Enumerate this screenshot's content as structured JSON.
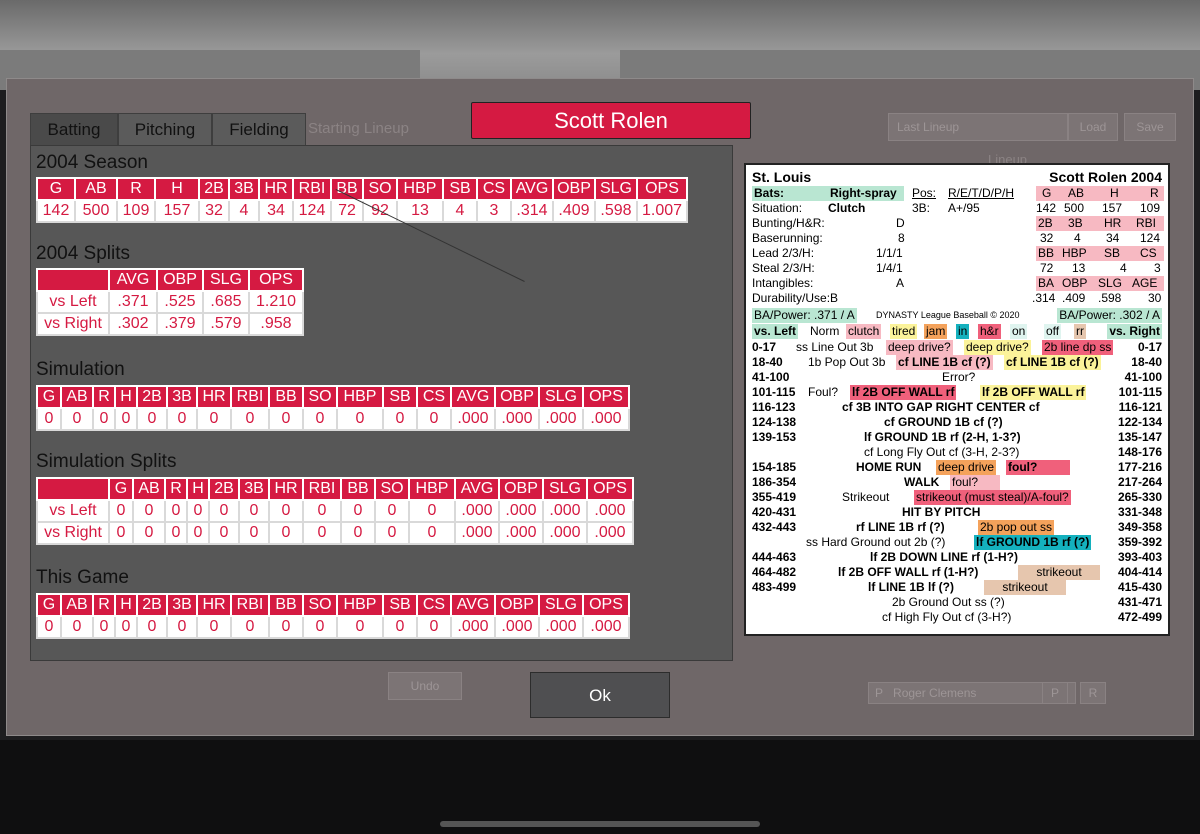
{
  "tabs": [
    {
      "label": "Batting",
      "active": true
    },
    {
      "label": "Pitching",
      "active": false
    },
    {
      "label": "Fielding",
      "active": false
    }
  ],
  "player_name": "Scott Rolen",
  "background": {
    "starting_lineup": "Starting Lineup",
    "last_lineup": "Last Lineup",
    "load": "Load",
    "save": "Save",
    "lineup": "Lineup",
    "undo": "Undo",
    "pitcher_pos": "P",
    "pitcher_name": "Roger Clemens",
    "p_label": "P",
    "r_label": "R"
  },
  "season": {
    "title": "2004 Season",
    "headers": [
      "G",
      "AB",
      "R",
      "H",
      "2B",
      "3B",
      "HR",
      "RBI",
      "BB",
      "SO",
      "HBP",
      "SB",
      "CS",
      "AVG",
      "OBP",
      "SLG",
      "OPS"
    ],
    "values": [
      "142",
      "500",
      "109",
      "157",
      "32",
      "4",
      "34",
      "124",
      "72",
      "92",
      "13",
      "4",
      "3",
      ".314",
      ".409",
      ".598",
      "1.007"
    ]
  },
  "splits": {
    "title": "2004 Splits",
    "headers": [
      "",
      "AVG",
      "OBP",
      "SLG",
      "OPS"
    ],
    "rows": [
      [
        "vs Left",
        ".371",
        ".525",
        ".685",
        "1.210"
      ],
      [
        "vs Right",
        ".302",
        ".379",
        ".579",
        ".958"
      ]
    ]
  },
  "simulation": {
    "title": "Simulation",
    "headers": [
      "G",
      "AB",
      "R",
      "H",
      "2B",
      "3B",
      "HR",
      "RBI",
      "BB",
      "SO",
      "HBP",
      "SB",
      "CS",
      "AVG",
      "OBP",
      "SLG",
      "OPS"
    ],
    "values": [
      "0",
      "0",
      "0",
      "0",
      "0",
      "0",
      "0",
      "0",
      "0",
      "0",
      "0",
      "0",
      "0",
      ".000",
      ".000",
      ".000",
      ".000"
    ]
  },
  "sim_splits": {
    "title": "Simulation Splits",
    "headers": [
      "",
      "G",
      "AB",
      "R",
      "H",
      "2B",
      "3B",
      "HR",
      "RBI",
      "BB",
      "SO",
      "HBP",
      "AVG",
      "OBP",
      "SLG",
      "OPS"
    ],
    "rows": [
      [
        "vs Left",
        "0",
        "0",
        "0",
        "0",
        "0",
        "0",
        "0",
        "0",
        "0",
        "0",
        "0",
        ".000",
        ".000",
        ".000",
        ".000"
      ],
      [
        "vs Right",
        "0",
        "0",
        "0",
        "0",
        "0",
        "0",
        "0",
        "0",
        "0",
        "0",
        "0",
        ".000",
        ".000",
        ".000",
        ".000"
      ]
    ]
  },
  "this_game": {
    "title": "This Game",
    "headers": [
      "G",
      "AB",
      "R",
      "H",
      "2B",
      "3B",
      "HR",
      "RBI",
      "BB",
      "SO",
      "HBP",
      "SB",
      "CS",
      "AVG",
      "OBP",
      "SLG",
      "OPS"
    ],
    "values": [
      "0",
      "0",
      "0",
      "0",
      "0",
      "0",
      "0",
      "0",
      "0",
      "0",
      "0",
      "0",
      "0",
      ".000",
      ".000",
      ".000",
      ".000"
    ]
  },
  "card": {
    "team": "St. Louis",
    "player_year": "Scott Rolen 2004",
    "bats_label": "Bats:",
    "bats_value": "Right-spray",
    "pos_label": "Pos:",
    "pos_value": "R/E/T/D/P/H",
    "situation_label": "Situation:",
    "situation_value": "Clutch",
    "pos_3b": "3B:",
    "rating_3b": "A+/95",
    "bunting_label": "Bunting/H&R:",
    "bunting_value": "D",
    "baserunning_label": "Baserunning:",
    "baserunning_value": "8",
    "lead_label": "Lead  2/3/H:",
    "lead_value": "1/1/1",
    "steal_label": "Steal  2/3/H:",
    "steal_value": "1/4/1",
    "intangibles_label": "Intangibles:",
    "intangibles_value": "A",
    "durability": "Durability/Use:B",
    "grid_h1": [
      "G",
      "AB",
      "H",
      "R"
    ],
    "grid_v1": [
      "142",
      "500",
      "157",
      "109"
    ],
    "grid_h2": [
      "2B",
      "3B",
      "HR",
      "RBI"
    ],
    "grid_v2": [
      "32",
      "4",
      "34",
      "124"
    ],
    "grid_h3": [
      "BB",
      "HBP",
      "SB",
      "CS"
    ],
    "grid_v3": [
      "72",
      "13",
      "4",
      "3"
    ],
    "grid_h4": [
      "BA",
      "OBP",
      "SLG",
      "AGE"
    ],
    "grid_v4": [
      ".314",
      ".409",
      ".598",
      "30"
    ],
    "ba_power_left": "BA/Power:  .371 / A",
    "copyright": "DYNASTY League Baseball © 2020",
    "ba_power_right": "BA/Power:  .302 / A",
    "vs_left": "vs. Left",
    "vs_right": "vs. Right",
    "tags": [
      "Norm",
      "clutch",
      "tired",
      "jam",
      "in",
      "h&r",
      "on",
      "off",
      "rr"
    ],
    "r1_l": "0-17",
    "r1_a": "ss Line Out 3b",
    "r1_b": "deep drive?",
    "r1_c": "deep drive?",
    "r1_d": "2b line dp ss",
    "r1_r": "0-17",
    "r2_l": "18-40",
    "r2_a": "1b Pop Out 3b",
    "r2_b": "cf LINE 1B cf (?)",
    "r2_c": "cf LINE 1B cf (?)",
    "r2_r": "18-40",
    "r3_l": "41-100",
    "r3_a": "Error?",
    "r3_r": "41-100",
    "r4_l": "101-115",
    "r4_a": "Foul?",
    "r4_b": "lf 2B OFF WALL rf",
    "r4_c": "lf 2B OFF WALL rf",
    "r4_r": "101-115",
    "r5_l": "116-123",
    "r5_a": "cf  3B INTO GAP RIGHT CENTER  cf",
    "r5_r": "116-121",
    "r6_l": "124-138",
    "r6_a": "cf  GROUND 1B  cf  (?)",
    "r6_r": "122-134",
    "r7_l": "139-153",
    "r7_a": "lf  GROUND 1B  rf  (2-H, 1-3?)",
    "r7_r": "135-147",
    "r8_a": "cf  Long Fly Out  cf  (3-H, 2-3?)",
    "r8_r": "148-176",
    "r9_l": "154-185",
    "r9_a": "HOME RUN",
    "r9_b": "deep drive",
    "r9_c": "foul?",
    "r9_r": "177-216",
    "r10_l": "186-354",
    "r10_a": "WALK",
    "r10_b": "foul?",
    "r10_r": "217-264",
    "r11_l": "355-419",
    "r11_a": "Strikeout",
    "r11_b": "strikeout (must steal)/A-foul?",
    "r11_r": "265-330",
    "r12_l": "420-431",
    "r12_a": "HIT BY PITCH",
    "r12_r": "331-348",
    "r13_l": "432-443",
    "r13_a": "rf  LINE 1B  rf  (?)",
    "r13_b": "2b  pop out  ss",
    "r13_r": "349-358",
    "r14_a": "ss  Hard Ground out  2b (?)",
    "r14_b": "lf  GROUND 1B rf (?)",
    "r14_r": "359-392",
    "r15_l": "444-463",
    "r15_a": "lf  2B DOWN LINE  rf (1-H?)",
    "r15_r": "393-403",
    "r16_l": "464-482",
    "r16_a": "lf  2B OFF WALL  rf (1-H?)",
    "r16_b": "strikeout",
    "r16_r": "404-414",
    "r17_l": "483-499",
    "r17_a": "lf  LINE 1B  lf (?)",
    "r17_b": "strikeout",
    "r17_r": "415-430",
    "r18_a": "2b  Ground Out  ss (?)",
    "r18_r": "431-471",
    "r19_a": "cf  High Fly Out  cf (3-H?)",
    "r19_r": "472-499"
  },
  "ok_label": "Ok"
}
